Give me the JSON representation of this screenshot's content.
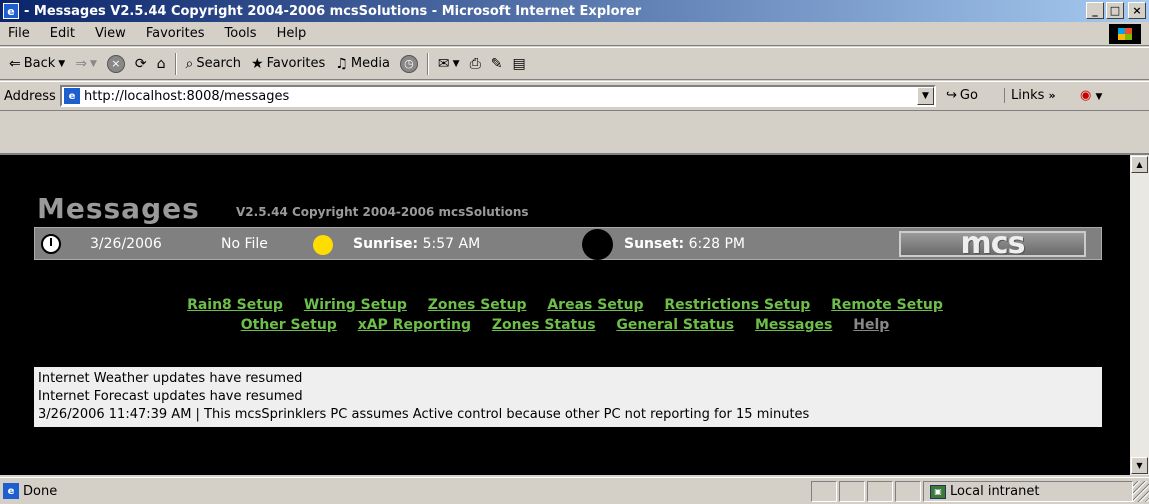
{
  "window": {
    "title": "- Messages V2.5.44 Copyright 2004-2006 mcsSolutions - Microsoft Internet Explorer",
    "minimize": "_",
    "maximize": "□",
    "close": "×"
  },
  "menu": {
    "items": [
      "File",
      "Edit",
      "View",
      "Favorites",
      "Tools",
      "Help"
    ]
  },
  "toolbar": {
    "back": "Back",
    "search": "Search",
    "favorites": "Favorites",
    "media": "Media"
  },
  "address": {
    "label": "Address",
    "url": "http://localhost:8008/messages",
    "go": "Go",
    "links": "Links"
  },
  "page": {
    "title": "Messages",
    "version": "V2.5.44 Copyright 2004-2006 mcsSolutions",
    "date": "3/26/2006",
    "file": "No File",
    "sunrise_label": "Sunrise:",
    "sunrise_time": "5:57 AM",
    "sunset_label": "Sunset:",
    "sunset_time": "6:28 PM",
    "logo": "mcs",
    "nav_row1": [
      "Rain8 Setup",
      "Wiring Setup",
      "Zones Setup",
      "Areas Setup",
      "Restrictions Setup",
      "Remote Setup"
    ],
    "nav_row2": [
      "Other Setup",
      "xAP Reporting",
      "Zones Status",
      "General Status",
      "Messages",
      "Help"
    ],
    "messages": [
      "Internet Weather updates have resumed",
      "Internet Forecast updates have resumed",
      "3/26/2006 11:47:39 AM | This mcsSprinklers PC assumes Active control because other PC not reporting for 15 minutes"
    ]
  },
  "status": {
    "text": "Done",
    "zone": "Local intranet"
  },
  "colors": {
    "link": "#6dbf4a",
    "link_inactive": "#888888",
    "page_bg": "#000000",
    "banner": "#808080"
  }
}
